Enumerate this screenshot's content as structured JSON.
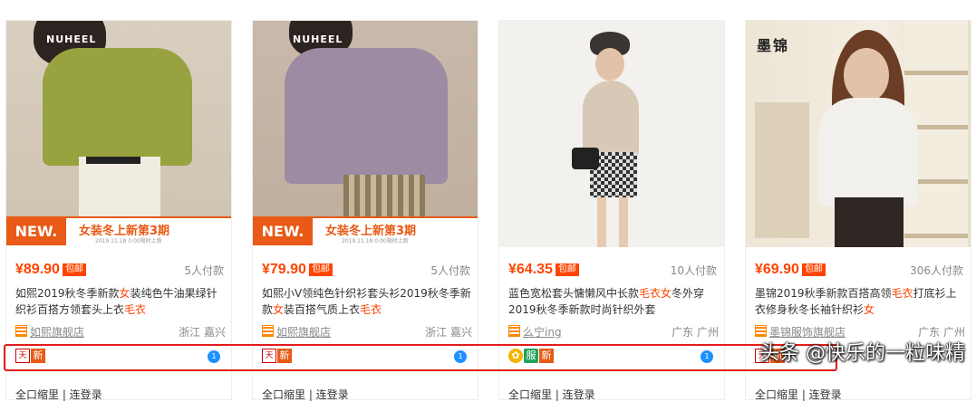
{
  "products": [
    {
      "brand": "NUHEEL",
      "banner": {
        "new": "NEW.",
        "title": "女装冬上新第3期",
        "date": "2019.11.18 0:00限时上新"
      },
      "price": "¥89.90",
      "baoyou": "包邮",
      "sold": "5人付款",
      "title_parts": [
        "如熙2019秋冬季新款",
        "女",
        "装纯色牛油果绿针织衫百搭方领套头上衣",
        "毛衣"
      ],
      "shop": "如熙旗舰店",
      "location": "浙江 嘉兴",
      "badges": [
        "tmall",
        "新"
      ],
      "shipping": "全口缩里 | 连登录"
    },
    {
      "brand": "NUHEEL",
      "banner": {
        "new": "NEW.",
        "title": "女装冬上新第3期",
        "date": "2019.11.18 0:00限时上新"
      },
      "price": "¥79.90",
      "baoyou": "包邮",
      "sold": "5人付款",
      "title_parts": [
        "如熙小V领纯色针织衫套头衫2019秋冬季新款",
        "女",
        "装百搭气质上衣",
        "毛衣"
      ],
      "shop": "如熙旗舰店",
      "location": "浙江 嘉兴",
      "badges": [
        "tmall",
        "新"
      ],
      "shipping": "全口缩里 | 连登录"
    },
    {
      "brand": "",
      "banner": null,
      "price": "¥64.35",
      "baoyou": "包邮",
      "sold": "10人付款",
      "title_parts": [
        "蓝色宽松套头慵懒风中长款",
        "毛衣女",
        "冬外穿2019秋冬季新款时尚针织外套",
        ""
      ],
      "shop": "么宁ing",
      "location": "广东 广州",
      "badges": [
        "gold",
        "服",
        "新"
      ],
      "shipping": "全口缩里 | 连登录"
    },
    {
      "brand": "墨锦",
      "banner": null,
      "price": "¥69.90",
      "baoyou": "包邮",
      "sold": "306人付款",
      "title_parts": [
        "墨锦2019秋季新款百搭高领",
        "毛衣",
        "打底衫上衣修身秋冬长袖针织衫",
        "女"
      ],
      "shop": "墨锦服饰旗舰店",
      "location": "广东 广州",
      "badges": [
        "tmall",
        "新"
      ],
      "shipping": "全口缩里 | 连登录"
    }
  ],
  "watermark": "头条 @快乐的一粒味精",
  "colors": {
    "accent": "#ff4400",
    "banner": "#e85a16",
    "highlight_box": "#e21b1b"
  }
}
